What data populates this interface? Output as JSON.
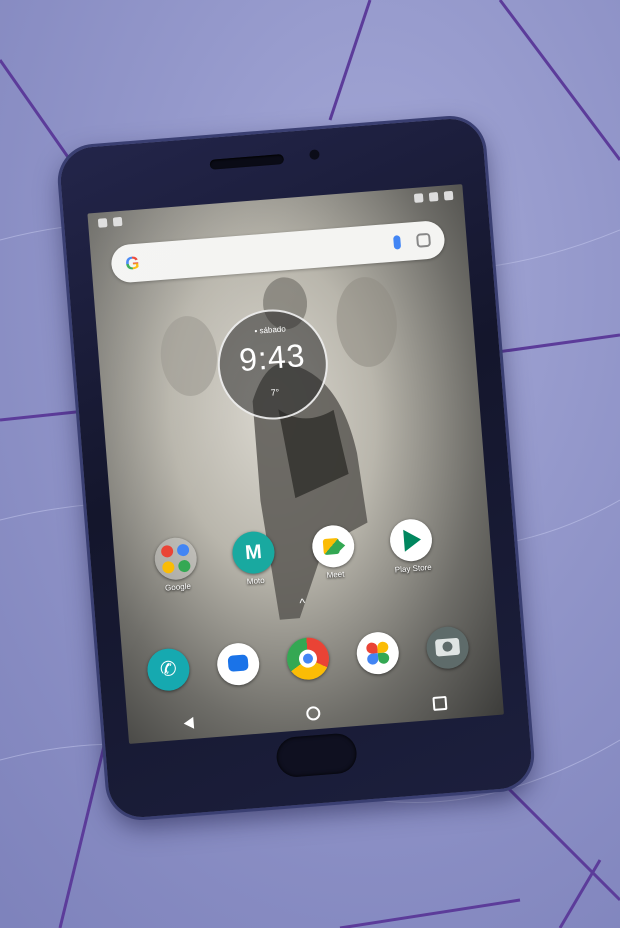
{
  "colors": {
    "fabric": "#8e93c8",
    "fabric_stitch": "#5c3c9a",
    "phone_body": "#1a1c36",
    "moto_teal": "#19a9a0"
  },
  "search": {
    "logo": "G",
    "mic_icon": "mic-icon",
    "lens_icon": "lens-icon"
  },
  "clock": {
    "date": "• sábado",
    "time": "9:43",
    "temp": "7°"
  },
  "apps": [
    {
      "label": "Google",
      "icon": "google-folder-icon"
    },
    {
      "label": "Moto",
      "icon": "moto-icon"
    },
    {
      "label": "Meet",
      "icon": "meet-icon"
    },
    {
      "label": "Play Store",
      "icon": "play-store-icon"
    }
  ],
  "dock": [
    {
      "icon": "phone-icon"
    },
    {
      "icon": "messages-icon"
    },
    {
      "icon": "chrome-icon"
    },
    {
      "icon": "photos-icon"
    },
    {
      "icon": "camera-icon"
    }
  ],
  "nav": {
    "back": "back-icon",
    "home": "home-icon",
    "recents": "recents-icon"
  }
}
